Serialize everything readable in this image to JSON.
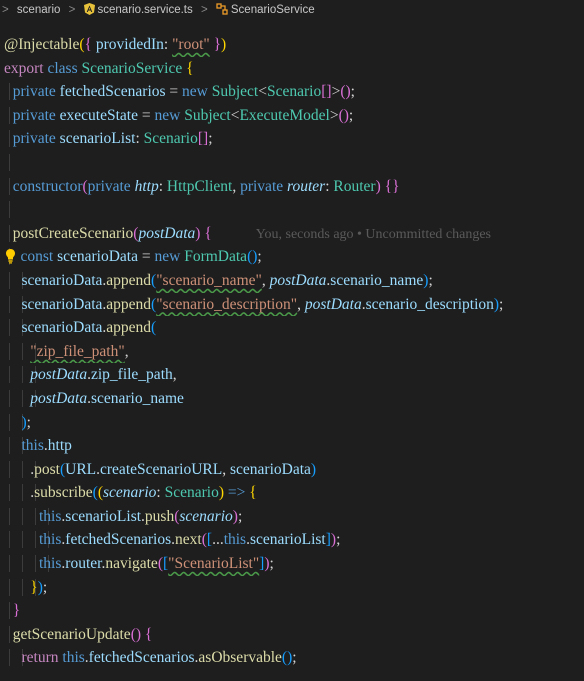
{
  "breadcrumb": {
    "items": [
      "scenario",
      "scenario.service.ts",
      "ScenarioService"
    ],
    "separator": ">"
  },
  "icons": {
    "file_icon": "angular-icon",
    "symbol_icon": "class-symbol-icon",
    "lightbulb": "lightbulb-icon"
  },
  "code": {
    "decorator": "@Injectable",
    "decorator_key": "providedIn",
    "decorator_value": "\"root\"",
    "export_kw": "export",
    "class_kw": "class",
    "class_name": "ScenarioService",
    "private_kw": "private",
    "new_kw": "new",
    "subject": "Subject",
    "scenario_type": "Scenario",
    "execute_type": "ExecuteModel",
    "field1": "fetchedScenarios",
    "field2": "executeState",
    "field3": "scenarioList",
    "constructor_kw": "constructor",
    "http_param": "http",
    "http_type": "HttpClient",
    "router_param": "router",
    "router_type": "Router",
    "method1": "postCreateScenario",
    "post_param": "postData",
    "blame_text": "You, seconds ago • Uncommitted changes",
    "const_kw": "const",
    "scenario_data": "scenarioData",
    "form_data": "FormData",
    "append": "append",
    "key_name": "\"scenario_name\"",
    "key_desc": "\"scenario_description\"",
    "key_zip": "\"zip_file_path\"",
    "prop_name": "scenario_name",
    "prop_desc": "scenario_description",
    "prop_zip": "zip_file_path",
    "this_kw": "this",
    "http_field": "http",
    "post_method": "post",
    "url_obj": "URL",
    "url_prop": "createScenarioURL",
    "subscribe": "subscribe",
    "scenario_param": "scenario",
    "push": "push",
    "next": "next",
    "router_field": "router",
    "navigate": "navigate",
    "route": "\"ScenarioList\"",
    "method2": "getScenarioUpdate",
    "return_kw": "return",
    "as_observable": "asObservable"
  }
}
